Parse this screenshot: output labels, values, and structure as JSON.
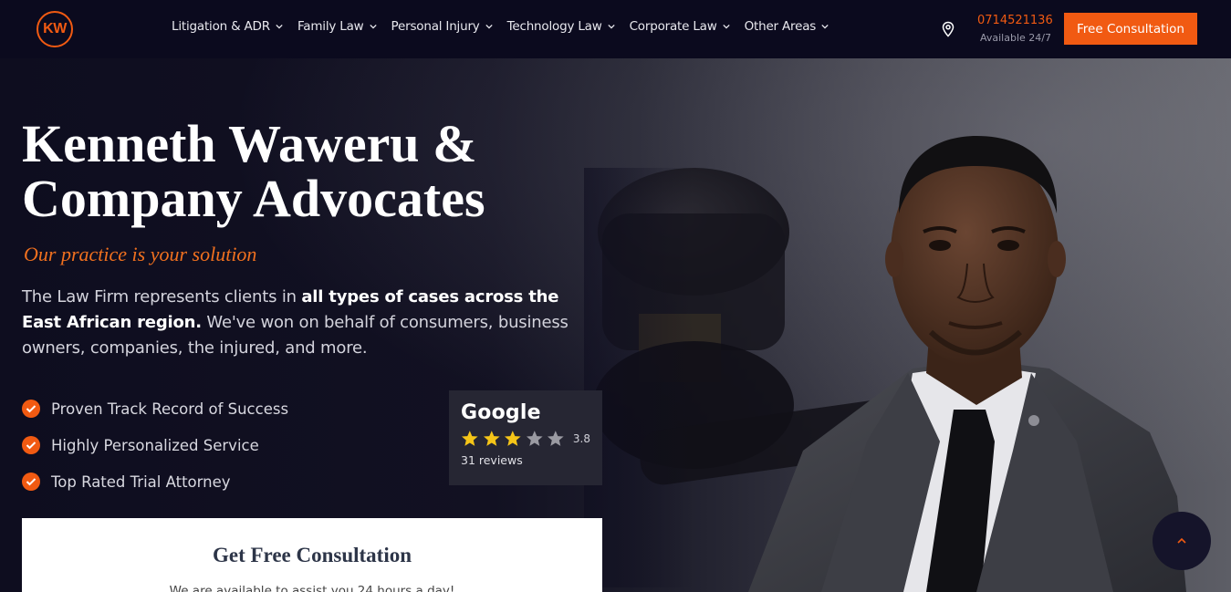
{
  "header": {
    "logo_text": "KW",
    "nav": [
      {
        "label": "Litigation & ADR"
      },
      {
        "label": "Family Law"
      },
      {
        "label": "Personal Injury"
      },
      {
        "label": "Technology Law"
      },
      {
        "label": "Corporate Law"
      },
      {
        "label": "Other Areas"
      }
    ],
    "phone": "0714521136",
    "availability": "Available 24/7",
    "cta_label": "Free Consultation"
  },
  "hero": {
    "title_line1": "Kenneth Waweru &",
    "title_line2": "Company Advocates",
    "tagline": "Our practice is your solution",
    "lead_part1": "The Law Firm represents clients in ",
    "lead_bold": "all types of cases across the East African region.",
    "lead_part2": " We've won on behalf of consumers, business owners, companies, the injured, and more.",
    "checks": [
      {
        "label": "Proven Track Record of Success"
      },
      {
        "label": "Highly Personalized Service"
      },
      {
        "label": "Top Rated Trial Attorney"
      }
    ]
  },
  "google": {
    "name": "Google",
    "rating": "3.8",
    "rating_value": 3.8,
    "reviews": "31 reviews"
  },
  "form": {
    "title": "Get Free Consultation",
    "subtitle": "We are available to assist you 24 hours a day!"
  },
  "colors": {
    "accent": "#f15a12",
    "background": "#0d0c1d",
    "star_filled": "#f5c518",
    "star_empty": "#9a9aa2"
  },
  "icons": {
    "location": "map-pin-icon",
    "check": "check-circle-icon",
    "scroll_top": "chevron-up-icon"
  }
}
